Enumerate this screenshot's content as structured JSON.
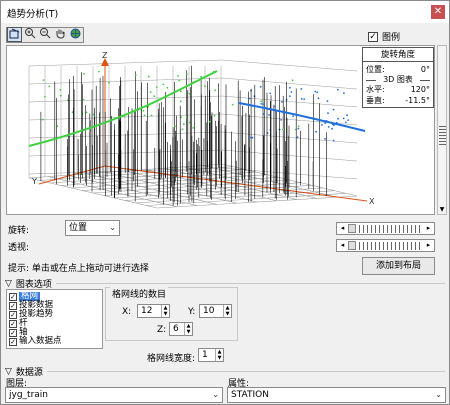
{
  "window": {
    "title": "趋势分析(T)",
    "close_label": "✕"
  },
  "toolbar": {
    "tools": [
      "select-rotate",
      "zoom-in",
      "zoom-out",
      "pan",
      "full-extent"
    ]
  },
  "legend_checkbox": {
    "label": "图例",
    "checked": true
  },
  "rotation_box": {
    "title": "旋转角度",
    "position_label": "位置:",
    "position_value": "0°",
    "divider_label": "3D 图表",
    "horizontal_label": "水平:",
    "horizontal_value": "120°",
    "vertical_label": "垂直:",
    "vertical_value": "-11.5°"
  },
  "plot_axes": {
    "x": "X",
    "y": "Y",
    "z": "Z"
  },
  "plot_colors": {
    "primary_trend": "#3fd13f",
    "secondary_trend": "#1c6fe0",
    "sticks": "#000000",
    "grid": "#9a9a9a",
    "axis_arrows": "#e05010"
  },
  "rotate": {
    "label": "旋转:",
    "value": "位置"
  },
  "perspective": {
    "label": "透视:"
  },
  "hint": {
    "text": "提示:  单击或在点上拖动可进行选择"
  },
  "add_to_layout_button": "添加到布局",
  "graph_options": {
    "header": "图表选项",
    "items": [
      {
        "label": "格网",
        "checked": true,
        "selected": true
      },
      {
        "label": "投影数据",
        "checked": true,
        "selected": false
      },
      {
        "label": "投影趋势",
        "checked": true,
        "selected": false
      },
      {
        "label": "杆",
        "checked": true,
        "selected": false
      },
      {
        "label": "轴",
        "checked": true,
        "selected": false
      },
      {
        "label": "输入数据点",
        "checked": true,
        "selected": false
      }
    ]
  },
  "grid_count": {
    "header": "格网线的数目",
    "x_label": "X:",
    "x_value": "12",
    "y_label": "Y:",
    "y_value": "10",
    "z_label": "Z:",
    "z_value": "6",
    "width_label": "格网线宽度:",
    "width_value": "1"
  },
  "data_source": {
    "header": "数据源",
    "layer_label": "图层:",
    "layer_value": "jyg_train",
    "attribute_label": "属性:",
    "attribute_value": "STATION"
  }
}
